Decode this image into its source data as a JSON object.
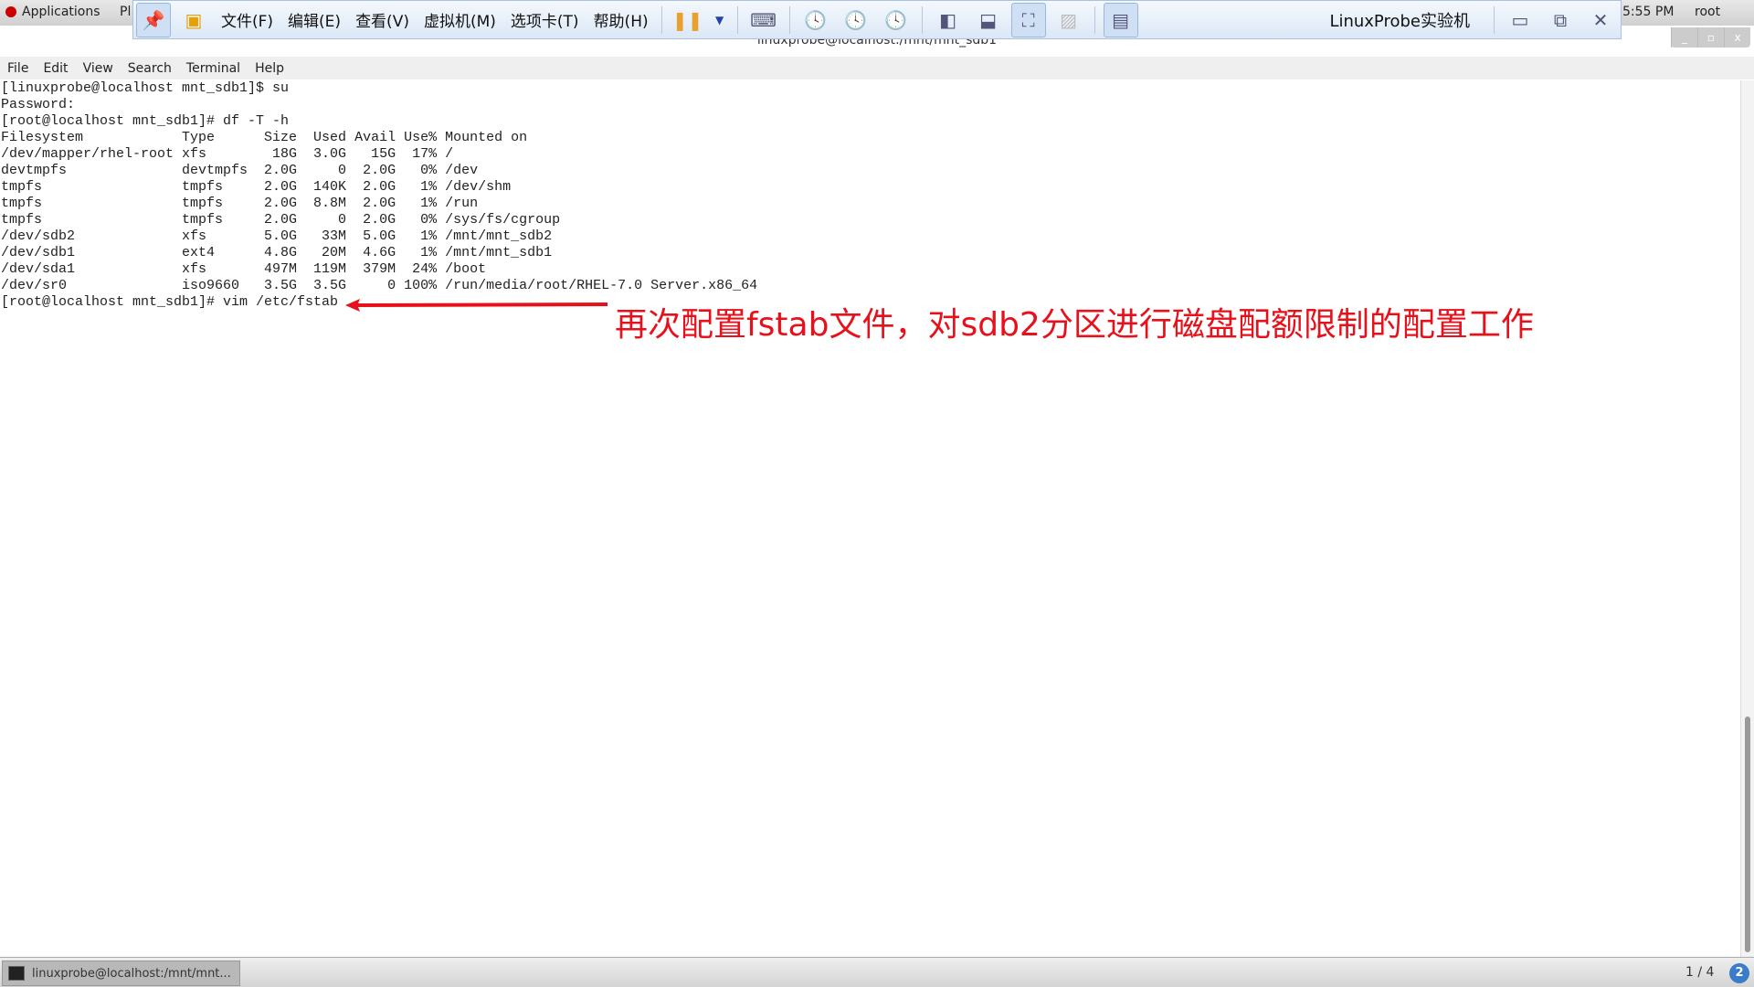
{
  "topbar": {
    "applications": "Applications",
    "places": "Pl",
    "clock": "5:55 PM",
    "user": "root"
  },
  "vmware": {
    "menus": [
      "文件(F)",
      "编辑(E)",
      "查看(V)",
      "虚拟机(M)",
      "选项卡(T)",
      "帮助(H)"
    ],
    "title": "LinuxProbe实验机",
    "icons": [
      "pin-icon",
      "vmware-logo-icon",
      "pause-icon",
      "dropdown-icon",
      "send-keys-icon",
      "snapshot-icon",
      "revert-snapshot-icon",
      "snapshot-manager-icon",
      "sidebar-view-icon",
      "console-view-icon",
      "fullscreen-icon",
      "unity-icon",
      "window-view-icon"
    ]
  },
  "terminal": {
    "title": "linuxprobe@localhost:/mnt/mnt_sdb1",
    "menu": [
      "File",
      "Edit",
      "View",
      "Search",
      "Terminal",
      "Help"
    ],
    "lines": [
      "[linuxprobe@localhost mnt_sdb1]$ su",
      "Password:",
      "[root@localhost mnt_sdb1]# df -T -h",
      "Filesystem            Type      Size  Used Avail Use% Mounted on",
      "/dev/mapper/rhel-root xfs        18G  3.0G   15G  17% /",
      "devtmpfs              devtmpfs  2.0G     0  2.0G   0% /dev",
      "tmpfs                 tmpfs     2.0G  140K  2.0G   1% /dev/shm",
      "tmpfs                 tmpfs     2.0G  8.8M  2.0G   1% /run",
      "tmpfs                 tmpfs     2.0G     0  2.0G   0% /sys/fs/cgroup",
      "/dev/sdb2             xfs       5.0G   33M  5.0G   1% /mnt/mnt_sdb2",
      "/dev/sdb1             ext4      4.8G   20M  4.6G   1% /mnt/mnt_sdb1",
      "/dev/sda1             xfs       497M  119M  379M  24% /boot",
      "/dev/sr0              iso9660   3.5G  3.5G     0 100% /run/media/root/RHEL-7.0 Server.x86_64",
      "[root@localhost mnt_sdb1]# vim /etc/fstab"
    ]
  },
  "annotation": {
    "text": "再次配置fstab文件，对sdb2分区进行磁盘配额限制的配置工作",
    "color": "#e8101a"
  },
  "taskbar": {
    "task": "linuxprobe@localhost:/mnt/mnt...",
    "pager": "1 / 4",
    "help": "2"
  }
}
